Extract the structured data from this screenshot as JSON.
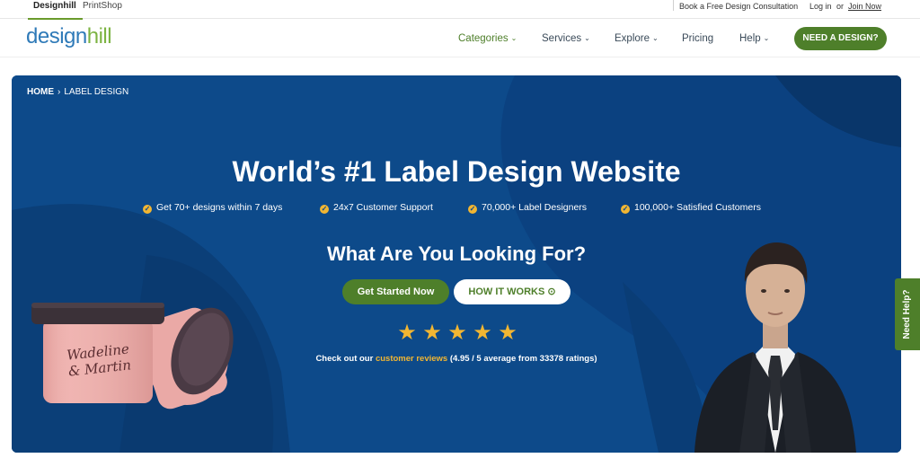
{
  "top_tabs": [
    "Designhill",
    "PrintShop"
  ],
  "top_links": {
    "consultation": "Book a Free Design Consultation",
    "login": "Log in",
    "or": "or",
    "join": "Join Now"
  },
  "logo": {
    "part1": "design",
    "part2": "hill"
  },
  "nav": {
    "categories": "Categories",
    "services": "Services",
    "explore": "Explore",
    "pricing": "Pricing",
    "help": "Help",
    "cta": "NEED A DESIGN?"
  },
  "breadcrumb": {
    "home": "HOME",
    "current": "LABEL DESIGN"
  },
  "hero": {
    "title": "World’s #1 Label Design Website",
    "features": [
      "Get 70+ designs within 7 days",
      "24x7 Customer Support",
      "70,000+ Label Designers",
      "100,000+ Satisfied Customers"
    ],
    "subtitle": "What Are You Looking For?",
    "primary_button": "Get Started Now",
    "secondary_button": "HOW IT WORKS ⊙",
    "rating_stars": 5,
    "review_prefix": "Check out our",
    "review_link": "customer reviews",
    "review_suffix": "(4.95 / 5 average from 33378 ratings)"
  },
  "jar_label": {
    "line1": "Wadeline",
    "line2": "& Martin"
  },
  "need_help": "Need Help?",
  "colors": {
    "brand_green": "#4e7f2a",
    "hero_blue": "#0d4a8a",
    "star_yellow": "#f2b632",
    "logo_blue": "#2f7ab8",
    "logo_green": "#7cb342"
  }
}
